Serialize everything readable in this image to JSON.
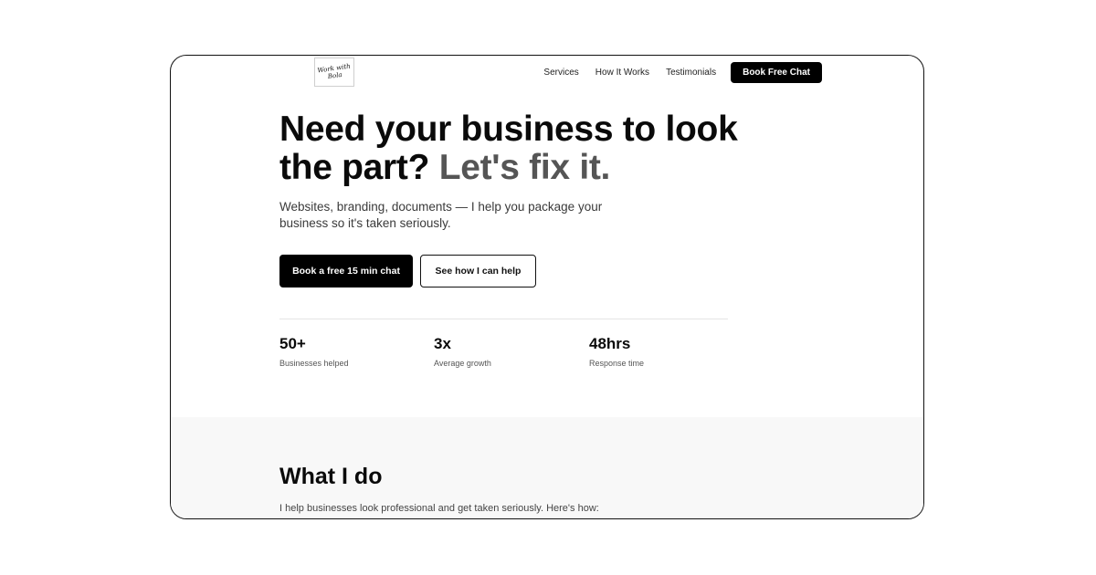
{
  "header": {
    "logo_text": "Work with\nBola",
    "nav": [
      "Services",
      "How It Works",
      "Testimonials"
    ],
    "cta_label": "Book Free Chat"
  },
  "hero": {
    "title_main": "Need your business to look the part?",
    "title_accent": "Let's fix it.",
    "subtitle": "Websites, branding, documents — I help you package your business so it's taken seriously.",
    "primary_cta": "Book a free 15 min chat",
    "secondary_cta": "See how I can help"
  },
  "stats": [
    {
      "value": "50+",
      "label": "Businesses helped"
    },
    {
      "value": "3x",
      "label": "Average growth"
    },
    {
      "value": "48hrs",
      "label": "Response time"
    }
  ],
  "services_section": {
    "title": "What I do",
    "subtitle": "I help businesses look professional and get taken seriously. Here's how:"
  },
  "colors": {
    "primary": "#000000",
    "accent_text": "#555555",
    "section_bg": "#f8f8f8"
  }
}
